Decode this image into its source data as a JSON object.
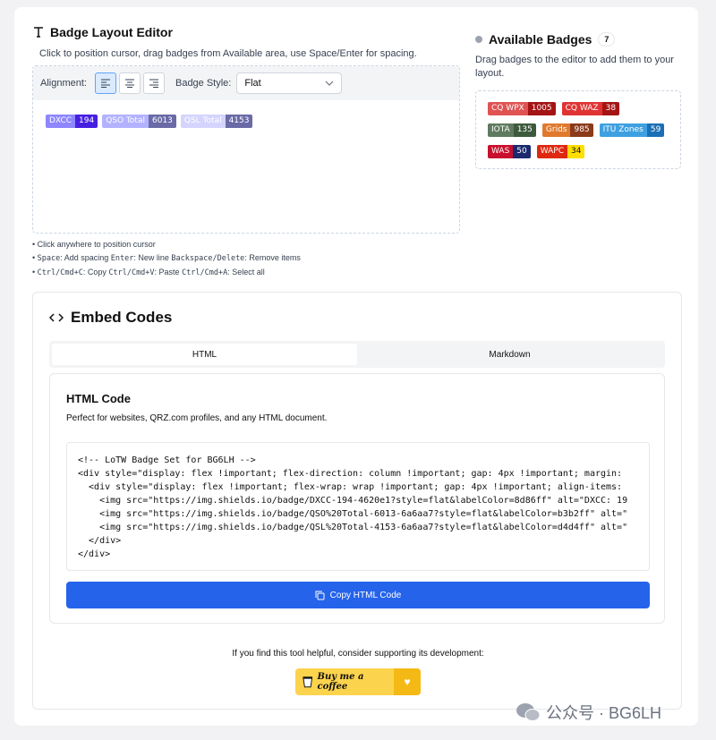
{
  "editor": {
    "title": "Badge Layout Editor",
    "subtitle": "Click to position cursor, drag badges from Available area, use Space/Enter for spacing.",
    "alignment_label": "Alignment:",
    "badge_style_label": "Badge Style:",
    "badge_style_value": "Flat",
    "badges": [
      {
        "label": "DXCC",
        "value": "194",
        "label_color": "#8d86ff",
        "value_color": "#4620e1"
      },
      {
        "label": "QSO Total",
        "value": "6013",
        "label_color": "#b3b2ff",
        "value_color": "#6a6aa7"
      },
      {
        "label": "QSL Total",
        "value": "4153",
        "label_color": "#d4d4ff",
        "value_color": "#6a6aa7"
      }
    ],
    "hints": {
      "line1": "• Click anywhere to position cursor",
      "line2_a": "• ",
      "line2_k1": "Space",
      "line2_b": ": Add spacing ",
      "line2_k2": "Enter",
      "line2_c": ": New line ",
      "line2_k3": "Backspace/Delete",
      "line2_d": ": Remove items",
      "line3_a": "• ",
      "line3_k1": "Ctrl/Cmd+C",
      "line3_b": ": Copy ",
      "line3_k2": "Ctrl/Cmd+V",
      "line3_c": ": Paste ",
      "line3_k3": "Ctrl/Cmd+A",
      "line3_d": ": Select all"
    }
  },
  "available": {
    "title": "Available Badges",
    "count": "7",
    "subtitle": "Drag badges to the editor to add them to your layout.",
    "badges": [
      {
        "label": "CQ WPX",
        "value": "1005",
        "label_color": "#e05353",
        "value_color": "#a51414"
      },
      {
        "label": "CQ WAZ",
        "value": "38",
        "label_color": "#e03434",
        "value_color": "#a51414"
      },
      {
        "label": "IOTA",
        "value": "135",
        "label_color": "#5f7a5f",
        "value_color": "#3d5a3d"
      },
      {
        "label": "Grids",
        "value": "985",
        "label_color": "#e07a2e",
        "value_color": "#8b3a1a"
      },
      {
        "label": "ITU Zones",
        "value": "59",
        "label_color": "#3ea0e0",
        "value_color": "#1c6fb5"
      },
      {
        "label": "WAS",
        "value": "50",
        "label_color": "#c8102e",
        "value_color": "#1a2a6c"
      },
      {
        "label": "WAPC",
        "value": "34",
        "label_color": "#de2910",
        "value_color": "#ffde00",
        "value_text_color": "#111111"
      }
    ]
  },
  "embed": {
    "title": "Embed Codes",
    "tabs": [
      {
        "label": "HTML"
      },
      {
        "label": "Markdown"
      }
    ],
    "code_title": "HTML Code",
    "code_desc": "Perfect for websites, QRZ.com profiles, and any HTML document.",
    "code_lines": [
      "<!-- LoTW Badge Set for BG6LH -->",
      "<div style=\"display: flex !important; flex-direction: column !important; gap: 4px !important; margin:",
      "  <div style=\"display: flex !important; flex-wrap: wrap !important; gap: 4px !important; align-items:",
      "    <img src=\"https://img.shields.io/badge/DXCC-194-4620e1?style=flat&labelColor=8d86ff\" alt=\"DXCC: 19",
      "    <img src=\"https://img.shields.io/badge/QSO%20Total-6013-6a6aa7?style=flat&labelColor=b3b2ff\" alt=\"",
      "    <img src=\"https://img.shields.io/badge/QSL%20Total-4153-6a6aa7?style=flat&labelColor=d4d4ff\" alt=\"",
      "  </div>",
      "</div>"
    ],
    "copy_label": "Copy HTML Code",
    "support_text": "If you find this tool helpful, consider supporting its development:",
    "coffee_label": "Buy me a coffee"
  },
  "watermark": {
    "text": "公众号 · BG6LH"
  }
}
